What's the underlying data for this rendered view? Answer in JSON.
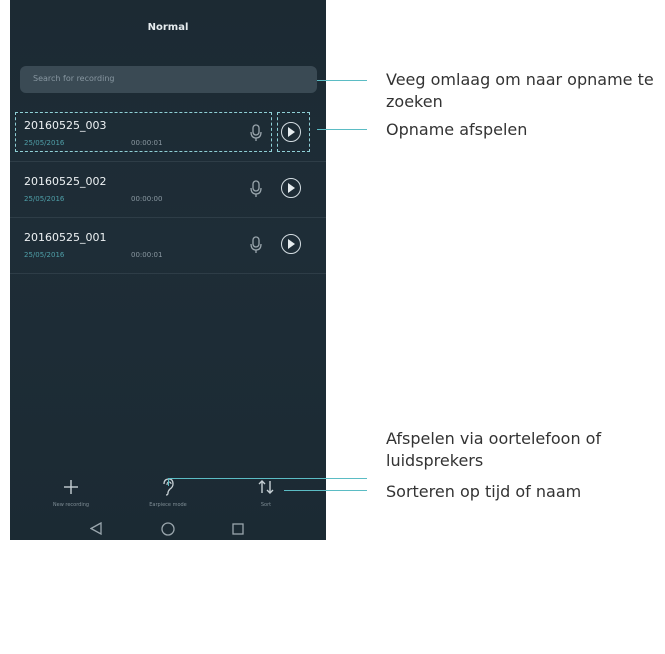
{
  "screen": {
    "title": "Normal",
    "search": {
      "placeholder": "Search for recording"
    },
    "recordings": [
      {
        "name": "20160525_003",
        "date": "25/05/2016",
        "duration": "00:00:01"
      },
      {
        "name": "20160525_002",
        "date": "25/05/2016",
        "duration": "00:00:00"
      },
      {
        "name": "20160525_001",
        "date": "25/05/2016",
        "duration": "00:00:01"
      }
    ],
    "bottom_bar": {
      "new_recording": "New recording",
      "earpiece_mode": "Earpiece mode",
      "sort": "Sort"
    }
  },
  "callouts": {
    "search": "Veeg omlaag om naar opname te zoeken",
    "play": "Opname afspelen",
    "earpiece": "Afspelen via oortelefoon of luidsprekers",
    "sort": "Sorteren op tijd of naam"
  },
  "colors": {
    "screen_bg": "#1c2a33",
    "accent": "#5bbcc4",
    "callout_text": "#333333"
  },
  "icons": [
    "microphone-icon",
    "play-icon",
    "plus-icon",
    "ear-icon",
    "sort-icon",
    "back-icon",
    "home-icon",
    "recent-apps-icon"
  ]
}
